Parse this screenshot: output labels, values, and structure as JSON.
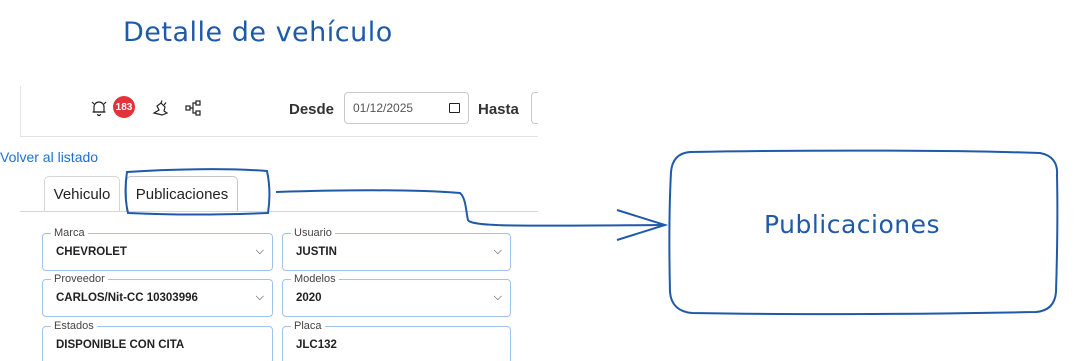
{
  "annotation": {
    "title": "Detalle de vehículo",
    "callout_label": "Publicaciones",
    "color": "#1f5aa8"
  },
  "topbar": {
    "notification_count": "183",
    "icons": [
      "bell-icon",
      "hand-icon",
      "hierarchy-icon"
    ],
    "desde_label": "Desde",
    "desde_value": "01/12/2025",
    "hasta_label": "Hasta"
  },
  "back_link": "Volver al listado",
  "tabs": [
    {
      "label": "Vehiculo",
      "active": false
    },
    {
      "label": "Publicaciones",
      "active": true
    }
  ],
  "form": {
    "marca": {
      "label": "Marca",
      "value": "CHEVROLET"
    },
    "usuario": {
      "label": "Usuario",
      "value": "JUSTIN"
    },
    "proveedor": {
      "label": "Proveedor",
      "value": "CARLOS/Nit-CC 10303996"
    },
    "modelos": {
      "label": "Modelos",
      "value": "2020"
    },
    "estados": {
      "label": "Estados",
      "value": "DISPONIBLE CON CITA"
    },
    "placa": {
      "label": "Placa",
      "value": "JLC132"
    }
  },
  "colors": {
    "badge": "#e5323a",
    "link": "#1c6fd1",
    "field_border": "#9fc3ea"
  }
}
